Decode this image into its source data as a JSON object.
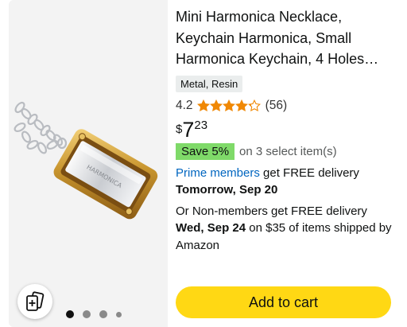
{
  "product": {
    "title": "Mini Harmonica Necklace, Keychain Harmonica, Small Harmonica Keychain, 4 Holes…",
    "material_chip": "Metal, Resin",
    "rating": 4.2,
    "rating_text": "4.2",
    "review_count_text": "(56)",
    "price": {
      "currency": "$",
      "whole": "7",
      "fraction": "23"
    },
    "save_badge": "Save 5%",
    "save_text": "on 3 select item(s)"
  },
  "delivery": {
    "prime_link": "Prime members",
    "prime_text": " get FREE delivery",
    "prime_date": "Tomorrow, Sep 20",
    "nonmember_text": "Or Non-members get FREE delivery",
    "nonmember_date": "Wed, Sep 24",
    "nonmember_tail": " on $35 of items shipped by Amazon"
  },
  "actions": {
    "add_to_cart": "Add to cart"
  },
  "carousel": {
    "count": 4,
    "active_index": 0
  },
  "colors": {
    "cart_button": "#ffd814",
    "save_badge": "#7fda69",
    "link": "#0066c0",
    "star": "#f08804"
  },
  "icons": {
    "compare": "compare-cards-icon",
    "star": "star-icon"
  }
}
